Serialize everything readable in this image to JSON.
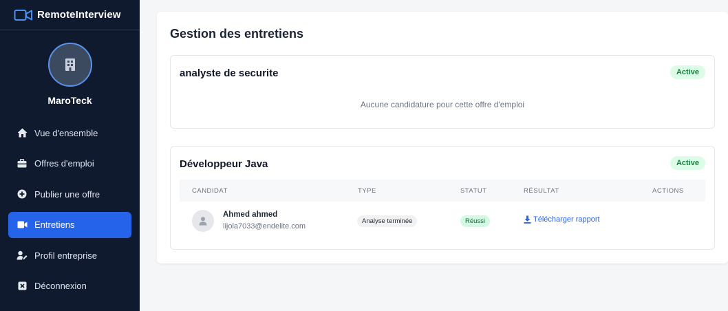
{
  "app": {
    "name": "RemoteInterview",
    "logo_icon": "video-camera-icon"
  },
  "company": {
    "name": "MaroTeck",
    "avatar_icon": "building-icon"
  },
  "sidebar": {
    "items": [
      {
        "label": "Vue d'ensemble",
        "icon": "home-icon",
        "active": false
      },
      {
        "label": "Offres d'emploi",
        "icon": "briefcase-icon",
        "active": false
      },
      {
        "label": "Publier une offre",
        "icon": "plus-circle-icon",
        "active": false
      },
      {
        "label": "Entretiens",
        "icon": "video-icon",
        "active": true
      },
      {
        "label": "Profil entreprise",
        "icon": "user-edit-icon",
        "active": false
      },
      {
        "label": "Déconnexion",
        "icon": "close-square-icon",
        "active": false
      }
    ]
  },
  "main": {
    "title": "Gestion des entretiens",
    "offers": [
      {
        "title": "analyste de securite",
        "status": "Active",
        "empty_message": "Aucune candidature pour cette offre d'emploi"
      },
      {
        "title": "Développeur Java",
        "status": "Active",
        "columns": [
          "CANDIDAT",
          "TYPE",
          "STATUT",
          "RÉSULTAT",
          "ACTIONS"
        ],
        "candidates": [
          {
            "name": "Ahmed ahmed",
            "email": "lijola7033@endelite.com",
            "type": "Analyse terminée",
            "status": "Réussi",
            "result_link": "Télécharger rapport"
          }
        ]
      }
    ]
  },
  "colors": {
    "sidebar_bg": "#0f1a2e",
    "accent": "#2563eb",
    "active_badge_bg": "#dcfce7",
    "active_badge_text": "#15803d"
  }
}
